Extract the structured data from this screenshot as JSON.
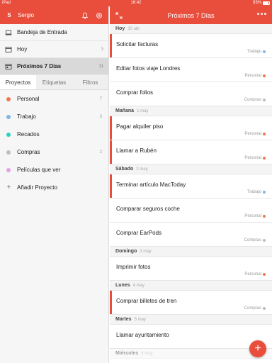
{
  "status": {
    "carrier": "iPad",
    "time": "16:42",
    "battery": "93%"
  },
  "sidebar": {
    "avatar_letter": "S",
    "user": "Sergio",
    "nav": [
      {
        "label": "Bandeja de Entrada",
        "count": ""
      },
      {
        "label": "Hoy",
        "count": "3"
      },
      {
        "label": "Próximos 7 Días",
        "count": "11"
      }
    ],
    "tabs": [
      "Proyectos",
      "Etiquetas",
      "Filtros"
    ],
    "projects": [
      {
        "label": "Personal",
        "count": "7",
        "color": "#f0784a"
      },
      {
        "label": "Trabajo",
        "count": "3",
        "color": "#7fb5e8"
      },
      {
        "label": "Recados",
        "count": "",
        "color": "#27d3c4"
      },
      {
        "label": "Compras",
        "count": "2",
        "color": "#bdbdbd"
      },
      {
        "label": "Películas que ver",
        "count": "",
        "color": "#e3a1e6"
      }
    ],
    "add_project": "Añadir Proyecto"
  },
  "main": {
    "title": "Próximos 7 Días",
    "days": [
      {
        "name": "Hoy",
        "date": "30 abr"
      },
      {
        "name": "Mañana",
        "date": "1 may"
      },
      {
        "name": "Sábado",
        "date": "2 may"
      },
      {
        "name": "Domingo",
        "date": "3 may"
      },
      {
        "name": "Lunes",
        "date": "4 may"
      },
      {
        "name": "Martes",
        "date": "5 may"
      },
      {
        "name": "Miércoles",
        "date": "6 may"
      }
    ],
    "tasks": [
      {
        "title": "Solicitar facturas",
        "project": "Trabajo",
        "color": "#7fb5e8"
      },
      {
        "title": "Editar fotos viaje Londres",
        "project": "Personal",
        "color": "#f0784a"
      },
      {
        "title": "Comprar folios",
        "project": "Compras",
        "color": "#bdbdbd"
      },
      {
        "title": "Pagar alquiler piso",
        "project": "Personal",
        "color": "#f0784a"
      },
      {
        "title": "Llamar a Rubén",
        "project": "Personal",
        "color": "#f0784a"
      },
      {
        "title": "Terminar artículo MacToday",
        "project": "Trabajo",
        "color": "#7fb5e8"
      },
      {
        "title": "Comparar seguros coche",
        "project": "Personal",
        "color": "#f0784a"
      },
      {
        "title": "Comprar EarPods",
        "project": "Compras",
        "color": "#bdbdbd"
      },
      {
        "title": "Imprimir fotos",
        "project": "Personal",
        "color": "#f0784a"
      },
      {
        "title": "Comprar billetes de tren",
        "project": "Compras",
        "color": "#bdbdbd"
      },
      {
        "title": "Llamar ayuntamiento",
        "project": "",
        "color": ""
      }
    ],
    "fab": "+"
  },
  "colors": {
    "accent": "#e94e3c"
  }
}
